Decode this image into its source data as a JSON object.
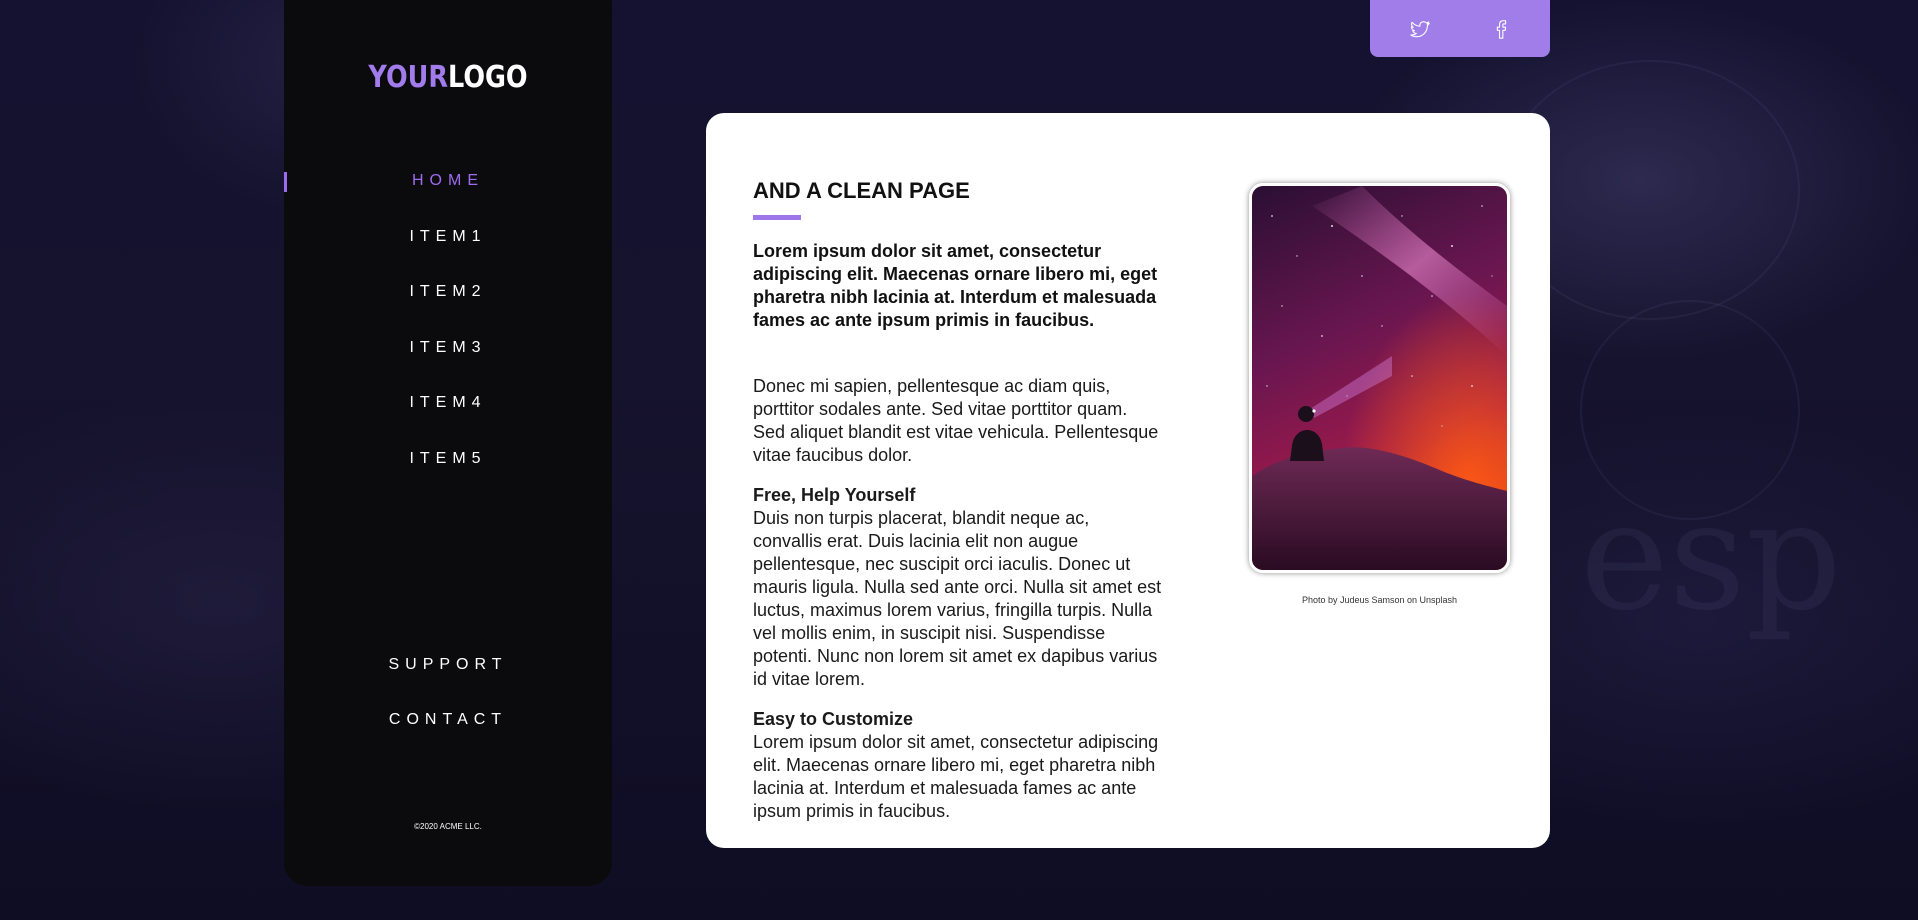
{
  "logo": {
    "part1": "YOUR",
    "part2": "LOGO"
  },
  "nav": {
    "items": [
      {
        "label": "HOME",
        "active": true
      },
      {
        "label": "ITEM1",
        "active": false
      },
      {
        "label": "ITEM2",
        "active": false
      },
      {
        "label": "ITEM3",
        "active": false
      },
      {
        "label": "ITEM4",
        "active": false
      },
      {
        "label": "ITEM5",
        "active": false
      }
    ],
    "secondary": [
      {
        "label": "SUPPORT"
      },
      {
        "label": "CONTACT"
      }
    ]
  },
  "copyright": "©2020 ACME LLC.",
  "social": {
    "icons": [
      "twitter-icon",
      "facebook-icon"
    ]
  },
  "colors": {
    "accent": "#9d6bee",
    "social_bg": "#a07de9",
    "sidebar_bg": "#0b0b0d",
    "page_bg": "#13112d",
    "card_bg": "#ffffff"
  },
  "main": {
    "title": "AND A CLEAN PAGE",
    "lead": "Lorem ipsum dolor sit amet, consectetur adipiscing elit. Maecenas ornare libero mi, eget pharetra nibh lacinia at. Interdum et malesuada fames ac ante ipsum primis in faucibus.",
    "paragraph": "Donec mi sapien, pellentesque ac diam quis, porttitor sodales ante. Sed vitae porttitor quam. Sed aliquet blandit est vitae vehicula. Pellentesque vitae faucibus dolor.",
    "section1": {
      "heading": "Free, Help Yourself",
      "body": "Duis non turpis placerat, blandit neque ac, convallis erat. Duis lacinia elit non augue pellentesque, nec suscipit orci iaculis. Donec ut mauris ligula. Nulla sed ante orci. Nulla sit amet est luctus, maximus lorem varius, fringilla turpis. Nulla vel mollis enim, in suscipit nisi. Suspendisse potenti. Nunc non lorem sit amet ex dapibus varius id vitae lorem."
    },
    "section2": {
      "heading": "Easy to Customize",
      "body": "Lorem ipsum dolor sit amet, consectetur adipiscing elit. Maecenas ornare libero mi, eget pharetra nibh lacinia at. Interdum et malesuada fames ac ante ipsum primis in faucibus."
    },
    "photo_caption": "Photo by Judeus Samson on Unsplash"
  }
}
